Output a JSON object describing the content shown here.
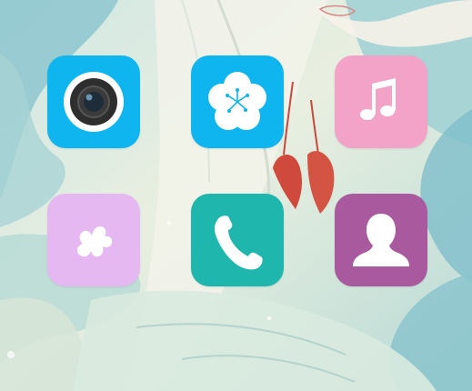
{
  "home_screen": {
    "apps": [
      {
        "id": "camera",
        "icon": "camera-icon",
        "color": "#0fb5ee"
      },
      {
        "id": "gallery",
        "icon": "flower-icon",
        "color": "#0fb5ee"
      },
      {
        "id": "music",
        "icon": "music-note-icon",
        "color": "#f3a2c8"
      },
      {
        "id": "games",
        "icon": "puzzle-piece-icon",
        "color": "#e6b8f1"
      },
      {
        "id": "phone",
        "icon": "phone-handset-icon",
        "color": "#1fb7ad"
      },
      {
        "id": "contacts",
        "icon": "person-icon",
        "color": "#a95a9e"
      }
    ]
  },
  "wallpaper": {
    "palette": [
      "#bfe0dc",
      "#e8eedb",
      "#8fc7cf",
      "#f3f0e6",
      "#c9473d"
    ]
  }
}
